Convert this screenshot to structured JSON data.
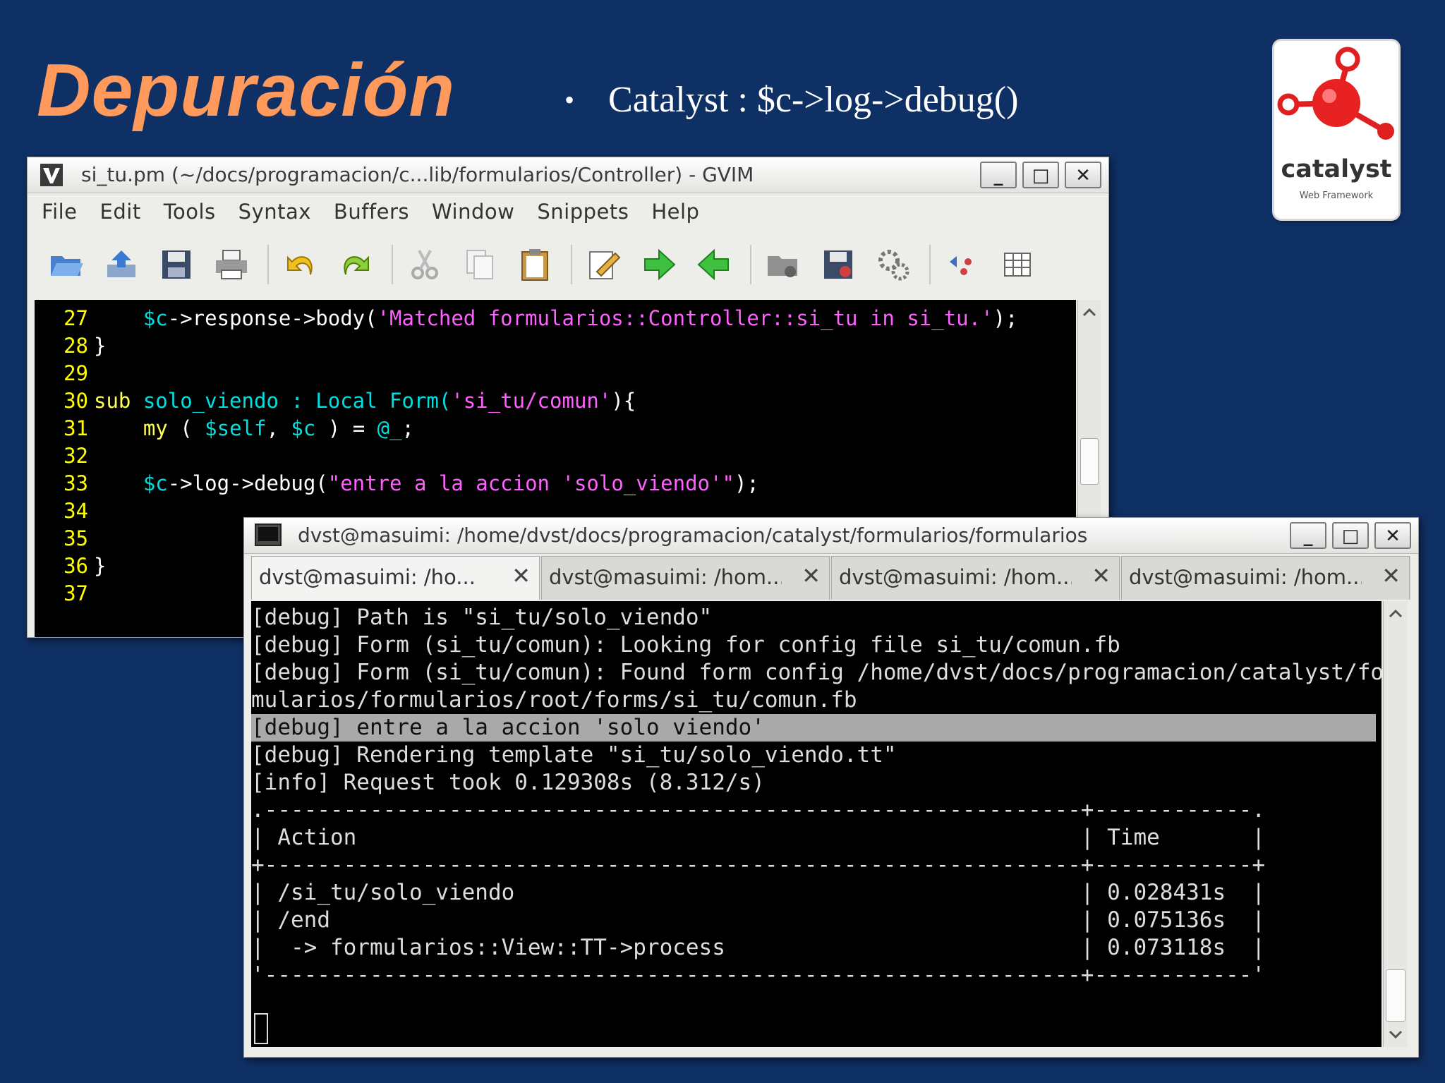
{
  "slide": {
    "title": "Depuración",
    "bullet": "Catalyst : $c->log->debug()",
    "logo_text": "catalyst",
    "logo_subtext": "Web Framework"
  },
  "gvim": {
    "title": "si_tu.pm (~/docs/programacion/c...lib/formularios/Controller) - GVIM",
    "menu": [
      "File",
      "Edit",
      "Tools",
      "Syntax",
      "Buffers",
      "Window",
      "Snippets",
      "Help"
    ],
    "toolbar_icons": [
      "open-folder-icon",
      "save-upload-icon",
      "floppy-icon",
      "print-icon",
      "undo-icon",
      "redo-icon",
      "cut-icon",
      "copy-icon",
      "paste-icon",
      "find-replace-icon",
      "forward-arrow-icon",
      "back-arrow-icon",
      "load-session-icon",
      "save-session-icon",
      "run-script-icon",
      "tags-icon",
      "table-icon"
    ],
    "code": [
      {
        "num": "27",
        "parts": [
          {
            "t": "    ",
            "c": ""
          },
          {
            "t": "$c",
            "c": "c-var"
          },
          {
            "t": "->response->body(",
            "c": ""
          },
          {
            "t": "'Matched formularios::Controller::si_tu in si_tu.'",
            "c": "c-str"
          },
          {
            "t": ");",
            "c": ""
          }
        ]
      },
      {
        "num": "28",
        "parts": [
          {
            "t": "}",
            "c": ""
          }
        ]
      },
      {
        "num": "29",
        "parts": []
      },
      {
        "num": "30",
        "parts": [
          {
            "t": "sub ",
            "c": "c-kw"
          },
          {
            "t": "solo_viendo : Local Form(",
            "c": "c-var"
          },
          {
            "t": "'si_tu/comun'",
            "c": "c-str"
          },
          {
            "t": "){",
            "c": ""
          }
        ]
      },
      {
        "num": "31",
        "parts": [
          {
            "t": "    ",
            "c": ""
          },
          {
            "t": "my",
            "c": "c-kw"
          },
          {
            "t": " ( ",
            "c": ""
          },
          {
            "t": "$self",
            "c": "c-var"
          },
          {
            "t": ", ",
            "c": ""
          },
          {
            "t": "$c",
            "c": "c-var"
          },
          {
            "t": " ) = ",
            "c": ""
          },
          {
            "t": "@_",
            "c": "c-var"
          },
          {
            "t": ";",
            "c": ""
          }
        ]
      },
      {
        "num": "32",
        "parts": []
      },
      {
        "num": "33",
        "parts": [
          {
            "t": "    ",
            "c": ""
          },
          {
            "t": "$c",
            "c": "c-var"
          },
          {
            "t": "->log->debug(",
            "c": ""
          },
          {
            "t": "\"entre a la accion 'solo",
            "c": "c-str"
          },
          {
            "t": "_",
            "c": "c-grn"
          },
          {
            "t": "viendo'\"",
            "c": "c-str"
          },
          {
            "t": ");",
            "c": ""
          }
        ]
      },
      {
        "num": "34",
        "parts": []
      },
      {
        "num": "35",
        "parts": []
      },
      {
        "num": "36",
        "parts": [
          {
            "t": "}",
            "c": ""
          }
        ]
      },
      {
        "num": "37",
        "parts": []
      }
    ]
  },
  "terminal": {
    "title": "dvst@masuimi: /home/dvst/docs/programacion/catalyst/formularios/formularios",
    "tabs": [
      {
        "label": "dvst@masuimi: /ho..."
      },
      {
        "label": "dvst@masuimi: /hom..."
      },
      {
        "label": "dvst@masuimi: /hom..."
      },
      {
        "label": "dvst@masuimi: /hom..."
      }
    ],
    "lines": [
      "[debug] Path is \"si_tu/solo_viendo\"",
      "[debug] Form (si_tu/comun): Looking for config file si_tu/comun.fb",
      "[debug] Form (si_tu/comun): Found form config /home/dvst/docs/programacion/catalyst/for",
      "mularios/formularios/root/forms/si_tu/comun.fb",
      "[debug] entre a la accion 'solo viendo'",
      "[debug] Rendering template \"si_tu/solo_viendo.tt\"",
      "[info] Request took 0.129308s (8.312/s)",
      ".--------------------------------------------------------------+------------.",
      "| Action                                                       | Time       |",
      "+--------------------------------------------------------------+------------+",
      "| /si_tu/solo_viendo                                           | 0.028431s  |",
      "| /end                                                         | 0.075136s  |",
      "|  -> formularios::View::TT->process                           | 0.073118s  |",
      "'--------------------------------------------------------------+------------'"
    ],
    "highlight_index": 4
  },
  "colors": {
    "slide_bg": "#0f3064",
    "title_orange": "#ff9a5c",
    "line_number_yellow": "#ffff00"
  }
}
